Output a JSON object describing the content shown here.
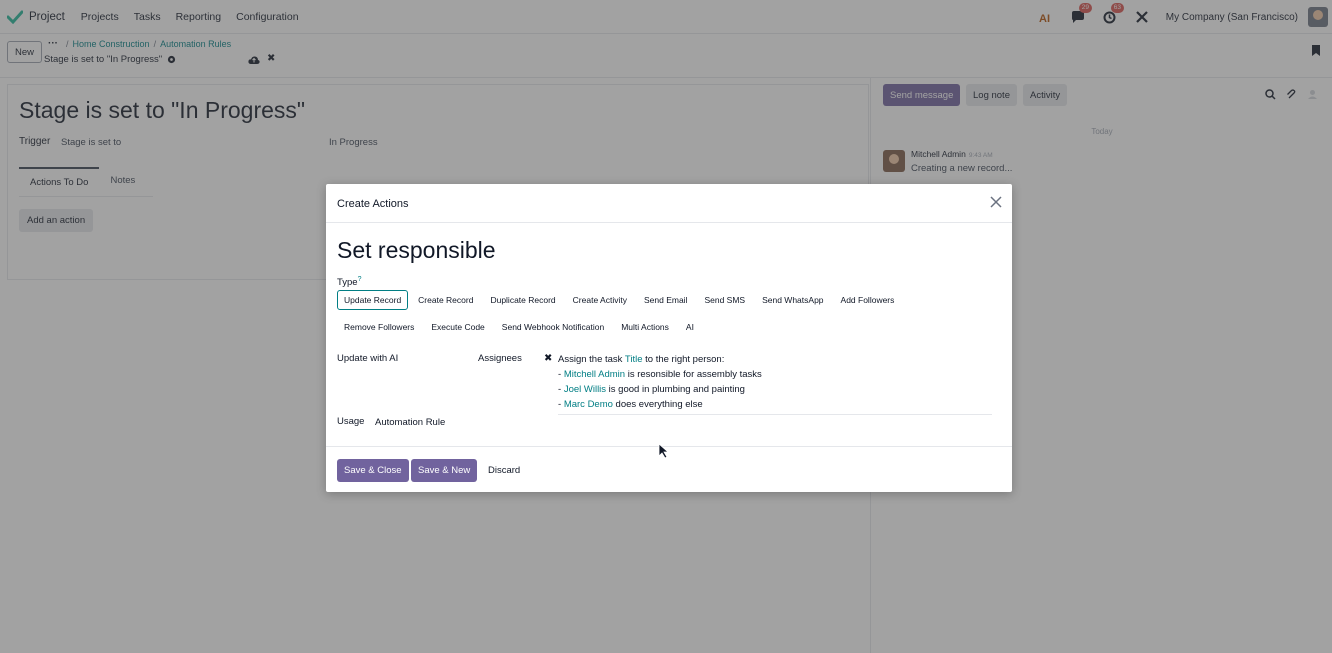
{
  "navbar": {
    "app_name": "Project",
    "menu": [
      "Projects",
      "Tasks",
      "Reporting",
      "Configuration"
    ],
    "messages_count": "29",
    "activities_count": "63",
    "company": "My Company (San Francisco)"
  },
  "control": {
    "new_label": "New",
    "breadcrumb": [
      "Home Construction",
      "Automation Rules"
    ],
    "record_title": "Stage is set to \"In Progress\""
  },
  "form": {
    "title": "Stage is set to \"In Progress\"",
    "trigger_label": "Trigger",
    "trigger_value": "Stage is set to",
    "trigger_stage": "In Progress",
    "tabs": [
      "Actions To Do",
      "Notes"
    ],
    "add_action_label": "Add an action"
  },
  "chatter": {
    "send_message": "Send message",
    "log_note": "Log note",
    "activity": "Activity",
    "day_separator": "Today",
    "message": {
      "author": "Mitchell Admin",
      "time": "9:43 AM",
      "body": "Creating a new record..."
    }
  },
  "modal": {
    "title": "Create Actions",
    "action_name": "Set responsible",
    "type_label": "Type",
    "type_options_row1": [
      "Update Record",
      "Create Record",
      "Duplicate Record",
      "Create Activity",
      "Send Email",
      "Send SMS",
      "Send WhatsApp",
      "Add Followers"
    ],
    "type_options_row2": [
      "Remove Followers",
      "Execute Code",
      "Send Webhook Notification",
      "Multi Actions",
      "AI"
    ],
    "selected_type": "Update Record",
    "update_label": "Update with AI",
    "field_label": "Assignees",
    "prompt": {
      "line1_pre": "Assign the task ",
      "line1_tag": "Title",
      "line1_post": " to the right person:",
      "line2_tag": "Mitchell Admin",
      "line2_post": " is resonsible for assembly tasks",
      "line3_tag": "Joel Willis",
      "line3_post": " is good in plumbing and painting",
      "line4_tag": "Marc Demo",
      "line4_post": " does everything else"
    },
    "usage_label": "Usage",
    "usage_value": "Automation Rule",
    "save_close": "Save & Close",
    "save_new": "Save & New",
    "discard": "Discard"
  },
  "colors": {
    "primary": "#71639e",
    "link": "#017e84",
    "brand_green": "#21b799",
    "badge": "#d9534f"
  }
}
